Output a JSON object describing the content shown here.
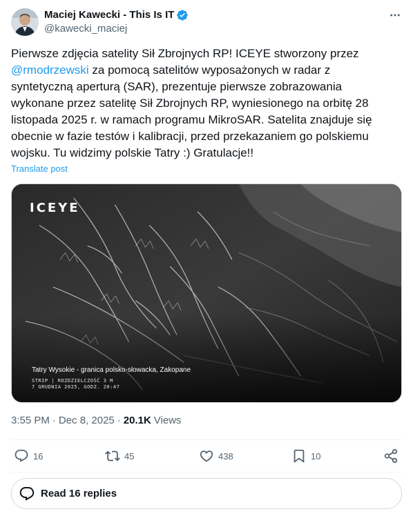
{
  "author": {
    "name": "Maciej Kawecki - This Is IT",
    "handle": "@kawecki_maciej"
  },
  "post": {
    "text_before_mention": "Pierwsze zdjęcia satelity Sił Zbrojnych RP! ICEYE stworzony przez ",
    "mention": "@rmodrzewski",
    "text_after_mention": " za pomocą satelitów wyposażonych w radar z syntetyczną aperturą (SAR), prezentuje pierwsze zobrazowania wykonane przez satelitę Sił Zbrojnych RP, wyniesionego na orbitę 28 listopada 2025 r. w ramach programu MikroSAR. Satelita znajduje się obecnie w fazie testów i kalibracji, przed przekazaniem go polskiemu wojsku. Tu widzimy polskie Tatry :) Gratulacje!!",
    "translate_label": "Translate post"
  },
  "media": {
    "logo_text": "ICEYE",
    "caption": "Tatry Wysokie - granica polsko-słowacka, Zakopane",
    "meta_line1": "STRIP | ROZDZIELCZOŚĆ 3 M",
    "meta_line2": "7 GRUDNIA 2025, GODZ. 20:47"
  },
  "timestamp": {
    "time": "3:55 PM",
    "separator": "·",
    "date": "Dec 8, 2025",
    "views_count": "20.1K",
    "views_label": "Views"
  },
  "actions": {
    "replies": "16",
    "reposts": "45",
    "likes": "438",
    "bookmarks": "10"
  },
  "read_replies_label": "Read 16 replies",
  "colors": {
    "accent": "#1d9bf0",
    "text": "#0f1419",
    "secondary": "#536471"
  },
  "icons": [
    "verified-badge-icon",
    "more-icon",
    "reply-icon",
    "repost-icon",
    "like-icon",
    "bookmark-icon",
    "share-icon",
    "replies-bubble-icon"
  ]
}
